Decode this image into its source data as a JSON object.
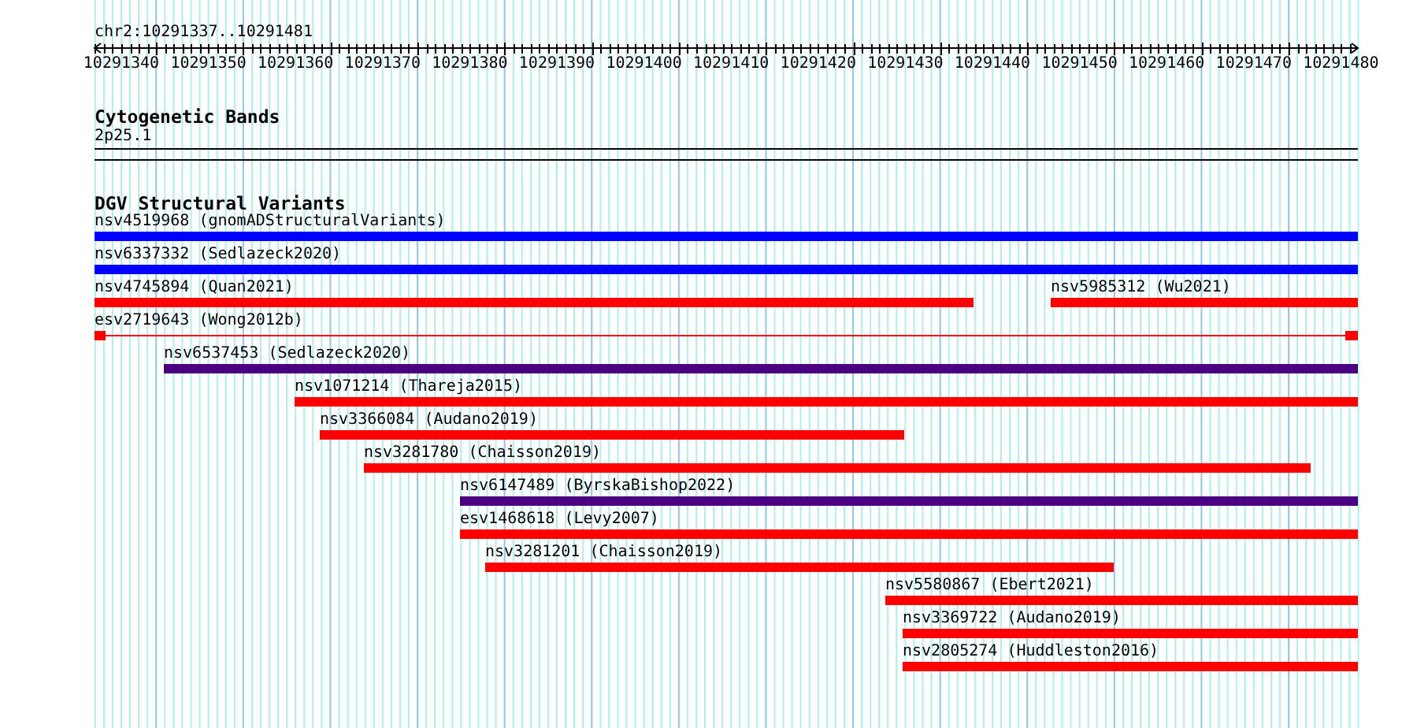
{
  "ruler": {
    "location": "chr2:10291337..10291481",
    "ticks": [
      "10291340",
      "10291350",
      "10291360",
      "10291370",
      "10291380",
      "10291390",
      "10291400",
      "10291410",
      "10291420",
      "10291430",
      "10291440",
      "10291450",
      "10291460",
      "10291470",
      "10291480"
    ]
  },
  "cytoband_track": {
    "title": "Cytogenetic Bands",
    "band": "2p25.1"
  },
  "variant_track": {
    "title": "DGV Structural Variants",
    "rows": [
      {
        "features": [
          {
            "label": "nsv4519968 (gnomADStructuralVariants)",
            "color": "#0000ff",
            "kind": "block"
          }
        ]
      },
      {
        "features": [
          {
            "label": "nsv6337332 (Sedlazeck2020)",
            "color": "#0000ff",
            "kind": "block"
          }
        ]
      },
      {
        "features": [
          {
            "label": "nsv4745894 (Quan2021)",
            "color": "#ff0000",
            "kind": "block"
          },
          {
            "label": "nsv5985312 (Wu2021)",
            "color": "#ff0000",
            "kind": "block"
          }
        ]
      },
      {
        "features": [
          {
            "label": "esv2719643 (Wong2012b)",
            "color": "#ff0000",
            "kind": "split"
          }
        ]
      },
      {
        "features": [
          {
            "label": "nsv6537453 (Sedlazeck2020)",
            "color": "#4b0082",
            "kind": "block"
          }
        ]
      },
      {
        "features": [
          {
            "label": "nsv1071214 (Thareja2015)",
            "color": "#ff0000",
            "kind": "block"
          }
        ]
      },
      {
        "features": [
          {
            "label": "nsv3366084 (Audano2019)",
            "color": "#ff0000",
            "kind": "block"
          }
        ]
      },
      {
        "features": [
          {
            "label": "nsv3281780 (Chaisson2019)",
            "color": "#ff0000",
            "kind": "block"
          }
        ]
      },
      {
        "features": [
          {
            "label": "nsv6147489 (ByrskaBishop2022)",
            "color": "#4b0082",
            "kind": "block"
          }
        ]
      },
      {
        "features": [
          {
            "label": "esv1468618 (Levy2007)",
            "color": "#ff0000",
            "kind": "block"
          }
        ]
      },
      {
        "features": [
          {
            "label": "nsv3281201 (Chaisson2019)",
            "color": "#ff0000",
            "kind": "block"
          }
        ]
      },
      {
        "features": [
          {
            "label": "nsv5580867 (Ebert2021)",
            "color": "#ff0000",
            "kind": "block"
          }
        ]
      },
      {
        "features": [
          {
            "label": "nsv3369722 (Audano2019)",
            "color": "#ff0000",
            "kind": "block"
          }
        ]
      },
      {
        "features": [
          {
            "label": "nsv2805274 (Huddleston2016)",
            "color": "#ff0000",
            "kind": "block"
          }
        ]
      }
    ]
  }
}
